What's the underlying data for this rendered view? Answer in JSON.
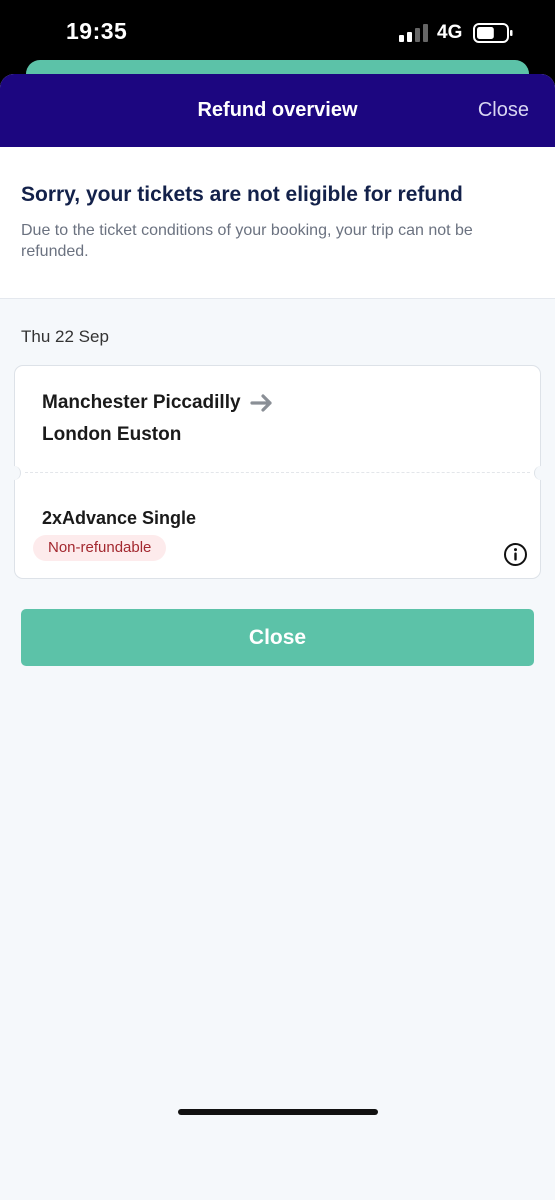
{
  "status_bar": {
    "time": "19:35",
    "network": "4G",
    "battery_level": 0.6
  },
  "header": {
    "title": "Refund overview",
    "close_label": "Close"
  },
  "notice": {
    "title": "Sorry, your tickets are not eligible for refund",
    "body": "Due to the ticket conditions of your booking, your trip can not be refunded."
  },
  "trip": {
    "date": "Thu 22 Sep",
    "origin": "Manchester Piccadilly",
    "destination": "London Euston",
    "ticket": "2xAdvance Single",
    "badge": "Non-refundable"
  },
  "footer": {
    "close_button": "Close"
  },
  "colors": {
    "header_bg": "#1c0680",
    "accent_green": "#5cc2a8",
    "badge_text": "#a3282f",
    "badge_bg": "#fdebec"
  },
  "icons": {
    "arrow": "arrow-right-icon",
    "info": "info-icon",
    "signal": "signal-icon",
    "battery": "battery-icon"
  }
}
